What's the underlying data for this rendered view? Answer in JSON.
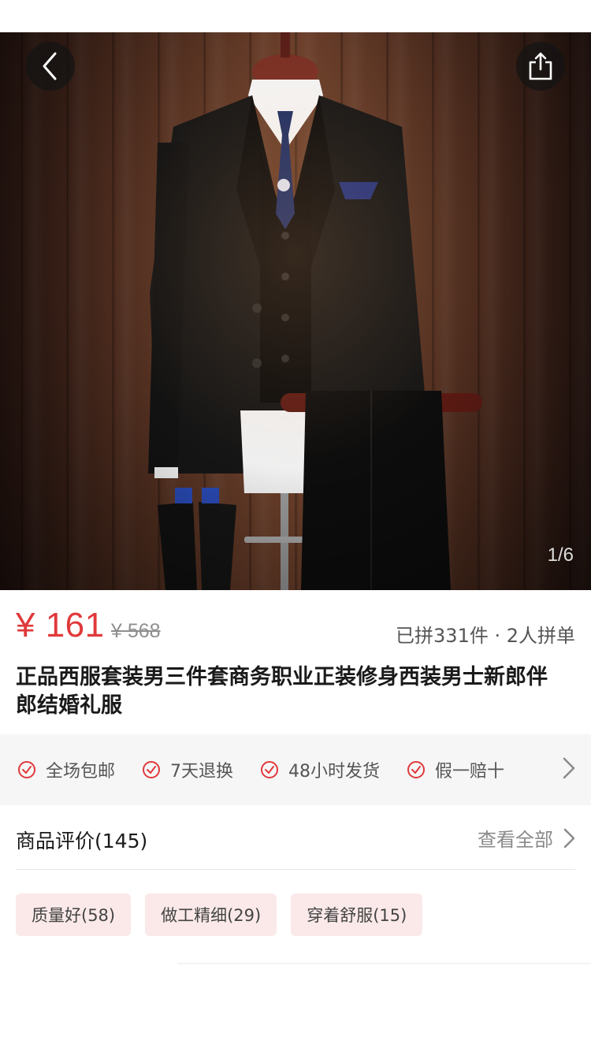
{
  "product": {
    "image_counter": "1/6",
    "price_current": "¥ 161",
    "price_original": "¥ 568",
    "group_info": "已拼331件 · 2人拼单",
    "title": " 正品西服套装男三件套商务职业正装修身西装男士新郎伴郎结婚礼服"
  },
  "services": [
    {
      "label": "全场包邮",
      "icon": "check-circle-icon"
    },
    {
      "label": "7天退换",
      "icon": "check-circle-icon"
    },
    {
      "label": "48小时发货",
      "icon": "check-circle-icon"
    },
    {
      "label": "假一赔十",
      "icon": "check-circle-icon"
    }
  ],
  "reviews": {
    "title": "商品评价(145)",
    "view_all": "查看全部",
    "tags": [
      "质量好(58)",
      "做工精细(29)",
      "穿着舒服(15)"
    ]
  },
  "icons": {
    "back": "chevron-left-icon",
    "share": "share-icon",
    "more": "chevron-right-icon"
  },
  "colors": {
    "price": "#e0393b",
    "tag_bg": "#fbe9e9",
    "service_check": "#e0393b"
  }
}
